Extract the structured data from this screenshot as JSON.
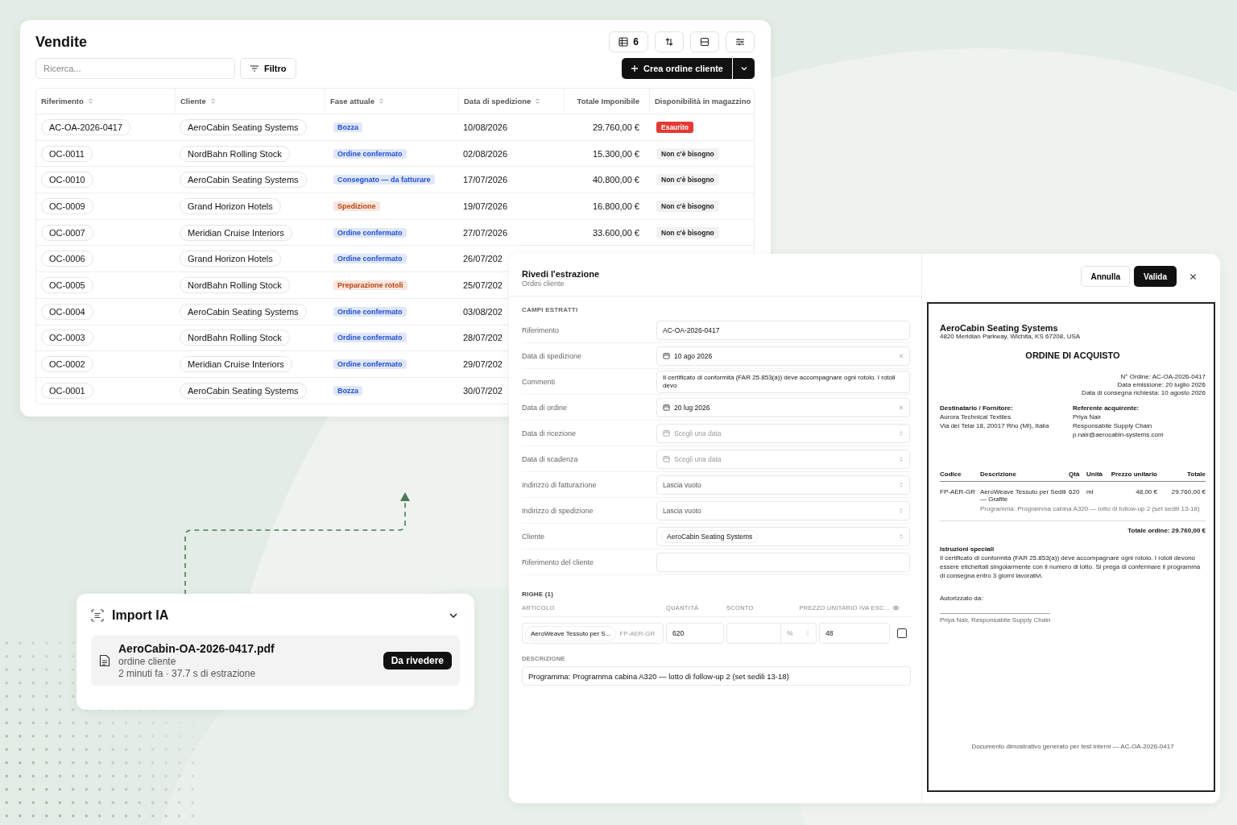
{
  "sales": {
    "title": "Vendite",
    "search": {
      "placeholder": "Ricerca..."
    },
    "filter_button": "Filtro",
    "columns_button": "6",
    "create_button": "Crea ordine cliente",
    "columns": [
      {
        "label": "Riferimento",
        "sortable": true
      },
      {
        "label": "Cliente",
        "sortable": true
      },
      {
        "label": "Fase attuale",
        "sortable": true
      },
      {
        "label": "Data di spedizione",
        "sortable": true
      },
      {
        "label": "Totale Imponibile",
        "sortable": false
      },
      {
        "label": "Disponibilità in magazzino",
        "sortable": false
      }
    ],
    "rows": [
      {
        "ref": "AC-OA-2026-0417",
        "client": "AeroCabin Seating Systems",
        "phase": {
          "label": "Bozza",
          "color": "#1d4ed8"
        },
        "date": "10/08/2026",
        "total": "29.760,00 €",
        "stock": {
          "label": "Esaurito",
          "kind": "out"
        }
      },
      {
        "ref": "OC-0011",
        "client": "NordBahn Rolling Stock",
        "phase": {
          "label": "Ordine confermato",
          "color": "#1d4ed8"
        },
        "date": "02/08/2026",
        "total": "15.300,00 €",
        "stock": {
          "label": "Non c'è bisogno",
          "kind": "ok"
        }
      },
      {
        "ref": "OC-0010",
        "client": "AeroCabin Seating Systems",
        "phase": {
          "label": "Consegnato — da fatturare",
          "color": "#1d4ed8"
        },
        "date": "17/07/2026",
        "total": "40.800,00 €",
        "stock": {
          "label": "Non c'è bisogno",
          "kind": "ok"
        }
      },
      {
        "ref": "OC-0009",
        "client": "Grand Horizon Hotels",
        "phase": {
          "label": "Spedizione",
          "color": "#c2410c"
        },
        "date": "19/07/2026",
        "total": "16.800,00 €",
        "stock": {
          "label": "Non c'è bisogno",
          "kind": "ok"
        }
      },
      {
        "ref": "OC-0007",
        "client": "Meridian Cruise Interiors",
        "phase": {
          "label": "Ordine confermato",
          "color": "#1d4ed8"
        },
        "date": "27/07/2026",
        "total": "33.600,00 €",
        "stock": {
          "label": "Non c'è bisogno",
          "kind": "ok"
        }
      },
      {
        "ref": "OC-0006",
        "client": "Grand Horizon Hotels",
        "phase": {
          "label": "Ordine confermato",
          "color": "#1d4ed8"
        },
        "date": "26/07/202"
      },
      {
        "ref": "OC-0005",
        "client": "NordBahn Rolling Stock",
        "phase": {
          "label": "Preparazione rotoli",
          "color": "#c2410c"
        },
        "date": "25/07/202"
      },
      {
        "ref": "OC-0004",
        "client": "AeroCabin Seating Systems",
        "phase": {
          "label": "Ordine confermato",
          "color": "#1d4ed8"
        },
        "date": "03/08/202"
      },
      {
        "ref": "OC-0003",
        "client": "NordBahn Rolling Stock",
        "phase": {
          "label": "Ordine confermato",
          "color": "#1d4ed8"
        },
        "date": "28/07/202"
      },
      {
        "ref": "OC-0002",
        "client": "Meridian Cruise Interiors",
        "phase": {
          "label": "Ordine confermato",
          "color": "#1d4ed8"
        },
        "date": "29/07/202"
      },
      {
        "ref": "OC-0001",
        "client": "AeroCabin Seating Systems",
        "phase": {
          "label": "Bozza",
          "color": "#1d4ed8"
        },
        "date": "30/07/202"
      }
    ]
  },
  "import": {
    "title": "Import IA",
    "expanded": true,
    "file": {
      "name": "AeroCabin-OA-2026-0417.pdf",
      "type": "ordine cliente",
      "meta": "2 minuti fa · 37.7 s di estrazione",
      "status": "Da rivedere"
    }
  },
  "review": {
    "title": "Rivedi l'estrazione",
    "subtitle": "Ordini cliente",
    "cancel_button": "Annulla",
    "validate_button": "Valida",
    "section": "CAMPI ESTRATTI",
    "fields": [
      {
        "label": "Riferimento",
        "kind": "text",
        "value": "AC-OA-2026-0417"
      },
      {
        "label": "Data di spedizione",
        "kind": "date",
        "value": "10 ago 2026"
      },
      {
        "label": "Commenti",
        "kind": "text",
        "value": "Il certificato di conformità (FAR 25.853(a)) deve accompagnare ogni rotolo. I rotoli devo"
      },
      {
        "label": "Data di ordine",
        "kind": "date",
        "value": "20 lug 2026"
      },
      {
        "label": "Data di ricezione",
        "kind": "date",
        "placeholder": "Scegli una data"
      },
      {
        "label": "Data di scadenza",
        "kind": "date",
        "placeholder": "Scegli una data"
      },
      {
        "label": "Indirizzo di fatturazione",
        "kind": "select",
        "placeholder": "Lascia vuoto"
      },
      {
        "label": "Indirizzo di spedizione",
        "kind": "select",
        "placeholder": "Lascia vuoto"
      },
      {
        "label": "Cliente",
        "kind": "select",
        "value": "AeroCabin Seating Systems"
      },
      {
        "label": "Riferimento del cliente",
        "kind": "text"
      }
    ],
    "lines_title": "RIGHE (1)",
    "line_columns": [
      "ARTICOLO",
      "QUANTITÀ",
      "SCONTO",
      "PREZZO UNITARIO IVA ESC..."
    ],
    "line": {
      "article": "AeroWeave Tessuto per S...",
      "code": "FP-AER-GR",
      "quantity": "620",
      "discount_unit": "%",
      "price": "48",
      "checked": false
    },
    "description_label": "DESCRIZIONE",
    "description": "Programma: Programma cabina A320 — lotto di follow-up 2 (set sedili 13-18)"
  },
  "document": {
    "company": "AeroCabin Seating Systems",
    "address": "4820 Meridian Parkway, Wichita, KS 67208, USA",
    "title": "ORDINE DI ACQUISTO",
    "meta": [
      "N° Ordine: AC-OA-2026-0417",
      "Data emissione: 20 luglio 2026",
      "Data di consegna richiesta: 10 agosto 2026"
    ],
    "supplier": {
      "heading": "Destinatario / Fornitore:",
      "lines": [
        "Aurora Technical Textiles",
        "Via dei Telai 18, 20017 Rho (MI), Italia"
      ]
    },
    "buyer": {
      "heading": "Referente acquirente:",
      "lines": [
        "Priya Nair",
        "Responsabile Supply Chain",
        "p.nair@aerocabin-systems.com"
      ]
    },
    "columns": [
      "Codice",
      "Descrizione",
      "Qtà",
      "Unità",
      "Prezzo unitario",
      "Totale"
    ],
    "row": [
      "FP-AER-GR",
      "AeroWeave Tessuto per Sedili — Grafite",
      "620",
      "ml",
      "48,00 €",
      "29.760,00 €"
    ],
    "row_note": "Programma: Programma cabina A320 — lotto di follow-up 2 (set sedili 13-18)",
    "total": "Totale ordine: 29.760,00 €",
    "instructions_heading": "Istruzioni speciali",
    "instructions": "Il certificato di conformità (FAR 25.853(a)) deve accompagnare ogni rotolo. I rotoli devono essere etichettati singolarmente con il numero di lotto. Si prega di confermare il programma di consegna entro 3 giorni lavorativi.",
    "authorized": "Autorizzato da:",
    "signature": "Priya Nair, Responsabile Supply Chain",
    "footer": "Documento dimostrativo generato per test interni — AC-OA-2026-0417"
  }
}
